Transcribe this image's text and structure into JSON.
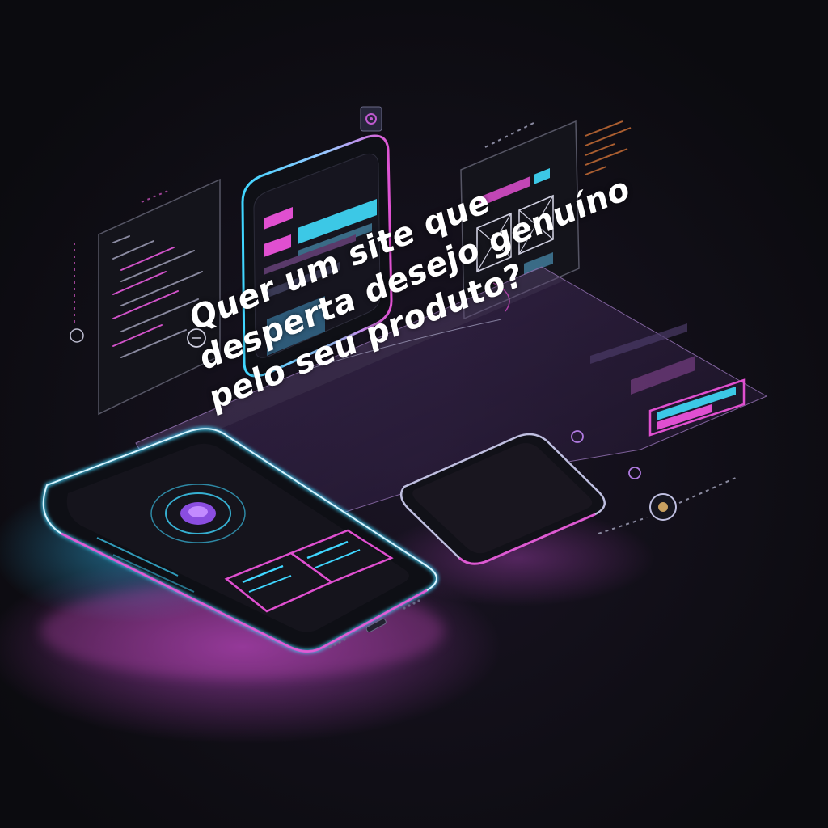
{
  "headline": {
    "line1": "Quer um site que",
    "line2": "desperta desejo genuíno",
    "line3": "pelo seu produto?"
  },
  "colors": {
    "background": "#0b0b0f",
    "neon_cyan": "#3fd6ff",
    "neon_pink": "#e04fd0",
    "neon_violet": "#9b5cff",
    "text": "#ffffff"
  },
  "icons": [
    "gear-icon",
    "target-icon",
    "image-placeholder-icon",
    "circle-badge-icon"
  ]
}
